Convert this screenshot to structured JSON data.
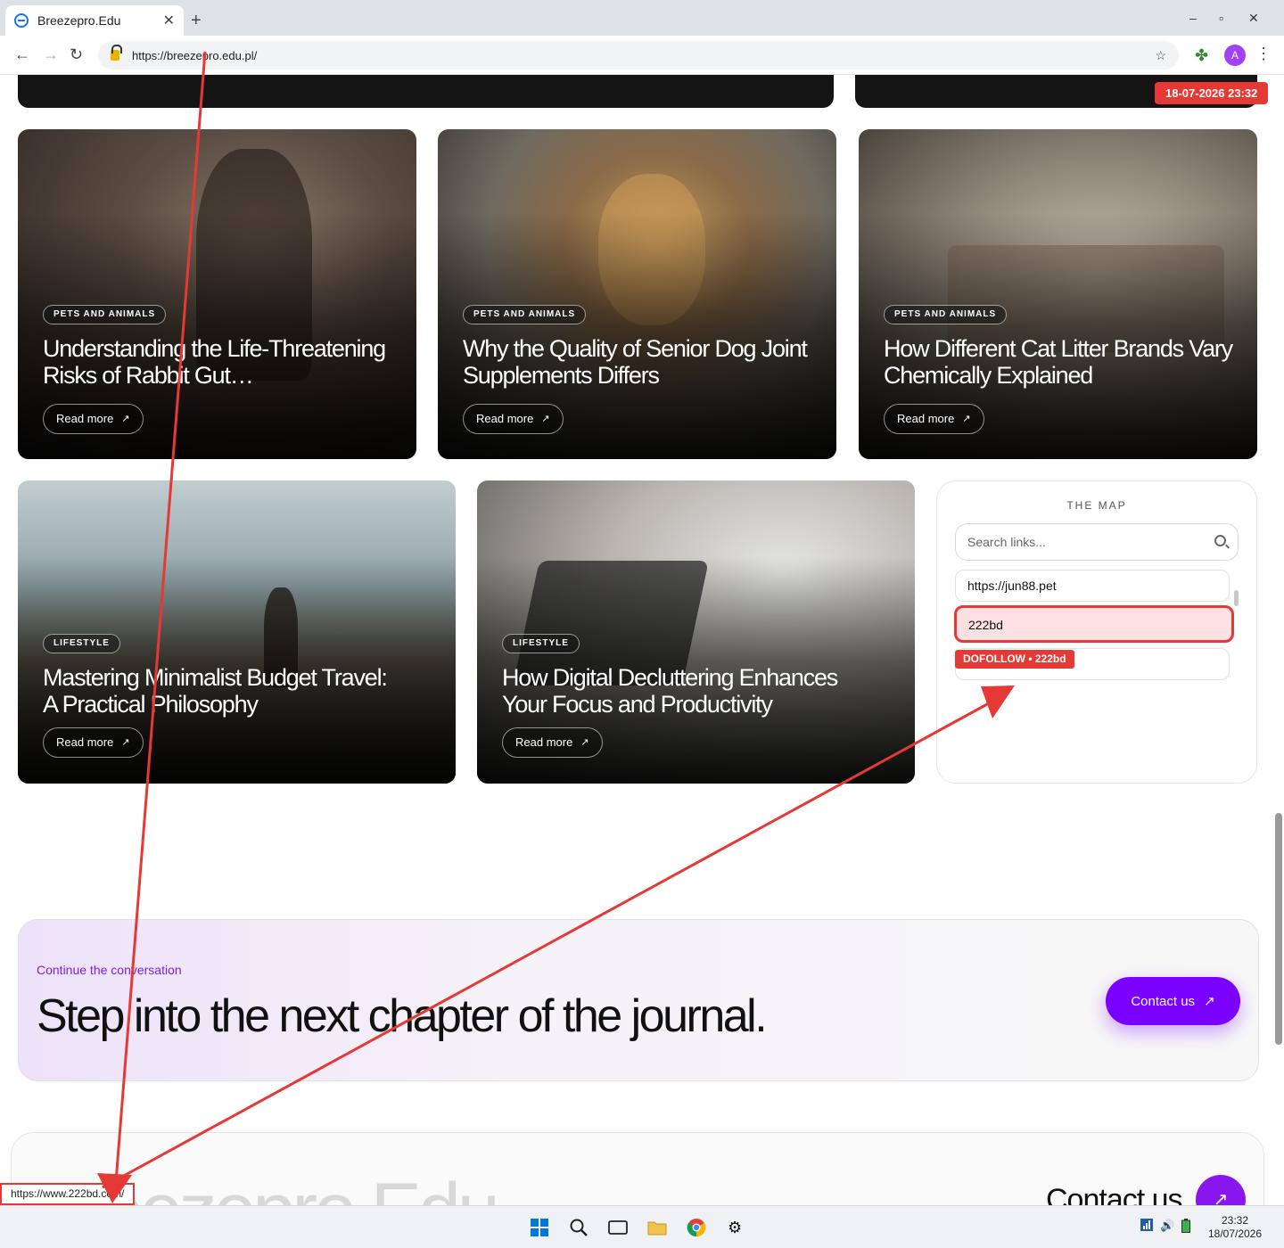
{
  "browser": {
    "tab_title": "Breezepro.Edu",
    "close_glyph": "✕",
    "new_tab_glyph": "+",
    "url": "https://breezepro.edu.pl/",
    "minimize_glyph": "–",
    "maximize_glyph": "▫",
    "window_close_glyph": "✕",
    "back_glyph": "←",
    "forward_glyph": "→",
    "reload_glyph": "↻",
    "star_glyph": "☆",
    "extension_glyph": "✤",
    "profile_initial": "A",
    "menu_glyph": "⋮"
  },
  "overlay": {
    "datetime_badge": "18-07-2026 23:32",
    "dofollow_label": "DOFOLLOW • 222bd",
    "status_url": "https://www.222bd.com/",
    "annotation_color": "#e53935"
  },
  "cards_row1": [
    {
      "category": "PETS AND ANIMALS",
      "title": "Understanding the Life-Threatening Risks of Rabbit Gut…",
      "cta": "Read more",
      "arrow": "↗"
    },
    {
      "category": "PETS AND ANIMALS",
      "title": "Why the Quality of Senior Dog Joint Supplements Differs",
      "cta": "Read more",
      "arrow": "↗"
    },
    {
      "category": "PETS AND ANIMALS",
      "title": "How Different Cat Litter Brands Vary Chemically Explained",
      "cta": "Read more",
      "arrow": "↗"
    }
  ],
  "cards_row2": [
    {
      "category": "LIFESTYLE",
      "title": "Mastering Minimalist Budget Travel: A Practical Philosophy",
      "cta": "Read more",
      "arrow": "↗"
    },
    {
      "category": "LIFESTYLE",
      "title": "How Digital Decluttering Enhances Your Focus and Productivity",
      "cta": "Read more",
      "arrow": "↗"
    }
  ],
  "map": {
    "title": "THE MAP",
    "search_placeholder": "Search links...",
    "links": [
      "https://jun88.pet",
      "222bd",
      ""
    ]
  },
  "cta": {
    "kicker": "Continue the conversation",
    "headline": "Step into the next chapter of the journal.",
    "button": "Contact us",
    "arrow": "↗",
    "accent": "#7a00ff"
  },
  "footer": {
    "brand": "Breezepro.Edu",
    "contact": "Contact us",
    "arrow": "↗"
  },
  "taskbar": {
    "time": "23:32",
    "date": "18/07/2026",
    "settings_glyph": "⚙",
    "speaker_glyph": "🔊"
  }
}
